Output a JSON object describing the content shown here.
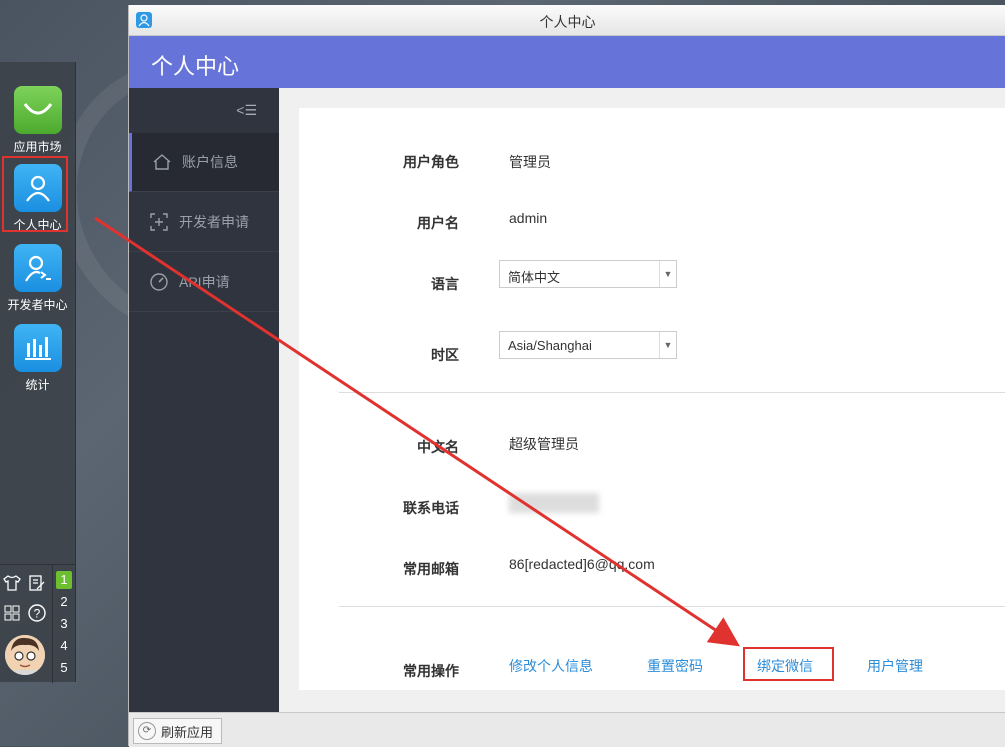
{
  "dock": {
    "apps": [
      {
        "label": "应用市场",
        "icon": "shopping-bag-icon"
      },
      {
        "label": "个人中心",
        "icon": "user-icon"
      },
      {
        "label": "开发者中心",
        "icon": "developer-icon"
      },
      {
        "label": "统计",
        "icon": "bar-chart-icon"
      }
    ],
    "workspaces": [
      "1",
      "2",
      "3",
      "4",
      "5"
    ]
  },
  "window": {
    "title": "个人中心",
    "header_title": "个人中心",
    "collapse_icon": "<☰"
  },
  "sidebar": {
    "items": [
      {
        "label": "账户信息",
        "icon": "home-icon"
      },
      {
        "label": "开发者申请",
        "icon": "developer-frame-icon"
      },
      {
        "label": "API申请",
        "icon": "speedometer-icon"
      }
    ]
  },
  "profile": {
    "role_label": "用户角色",
    "role_value": "管理员",
    "username_label": "用户名",
    "username_value": "admin",
    "language_label": "语言",
    "language_value": "简体中文",
    "timezone_label": "时区",
    "timezone_value": "Asia/Shanghai",
    "cname_label": "中文名",
    "cname_value": "超级管理员",
    "phone_label": "联系电话",
    "email_label": "常用邮箱",
    "email_value": "86[redacted]6@qq.com"
  },
  "actions": {
    "label": "常用操作",
    "edit_info": "修改个人信息",
    "reset_password": "重置密码",
    "bind_wechat": "绑定微信",
    "user_manage": "用户管理"
  },
  "statusbar": {
    "refresh_label": "刷新应用"
  },
  "colors": {
    "header": "#6673d9",
    "sidebar": "#30343e",
    "link": "#2b8cd8",
    "highlight": "#e0322f"
  }
}
